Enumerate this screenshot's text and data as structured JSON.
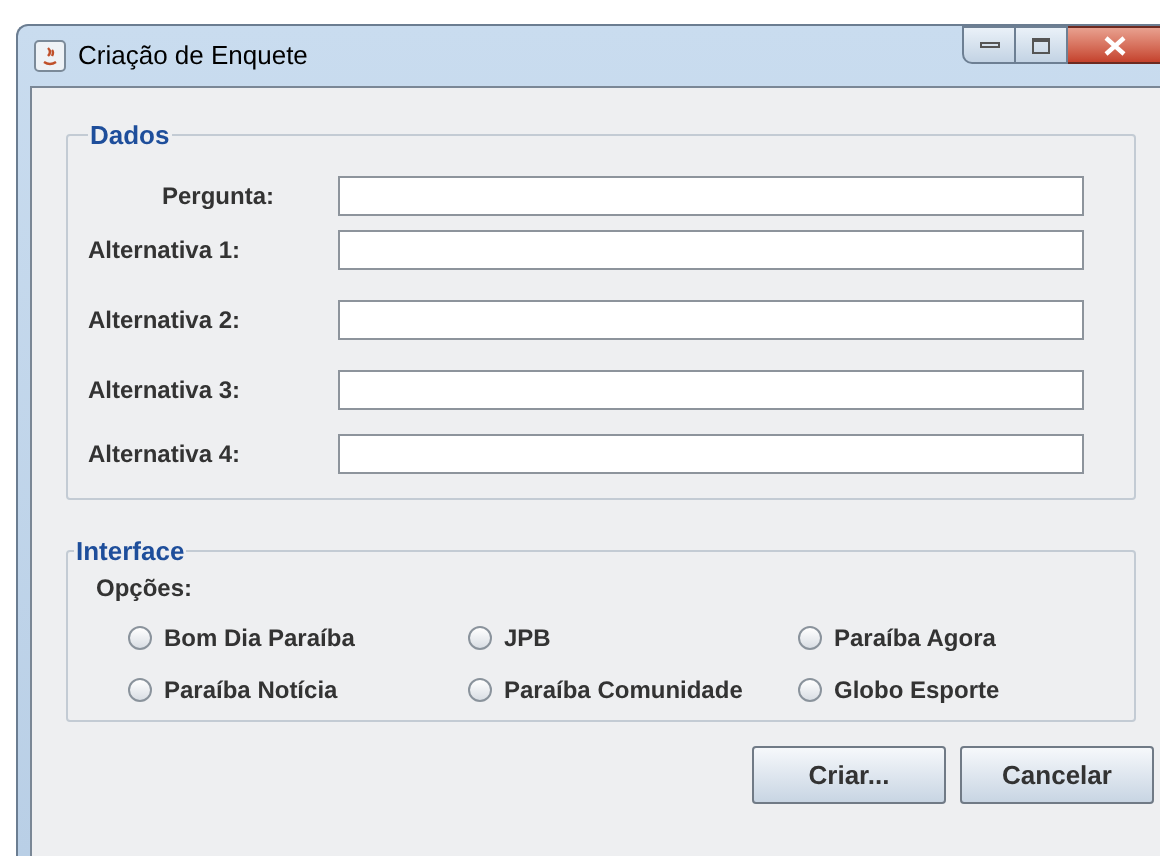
{
  "window": {
    "title": "Criação de Enquete"
  },
  "dados": {
    "legend": "Dados",
    "fields": [
      {
        "label": "Pergunta:"
      },
      {
        "label": "Alternativa 1:"
      },
      {
        "label": "Alternativa 2:"
      },
      {
        "label": "Alternativa 3:"
      },
      {
        "label": "Alternativa 4:"
      }
    ]
  },
  "interface": {
    "legend": "Interface",
    "options_label": "Opções:",
    "options": [
      {
        "label": "Bom Dia Paraíba",
        "selected": false
      },
      {
        "label": "JPB",
        "selected": false
      },
      {
        "label": "Paraíba Agora",
        "selected": false
      },
      {
        "label": "Paraíba Notícia",
        "selected": false
      },
      {
        "label": "Paraíba Comunidade",
        "selected": false
      },
      {
        "label": "Globo Esporte",
        "selected": false
      }
    ]
  },
  "buttons": [
    "Criar...",
    "Cancelar"
  ]
}
